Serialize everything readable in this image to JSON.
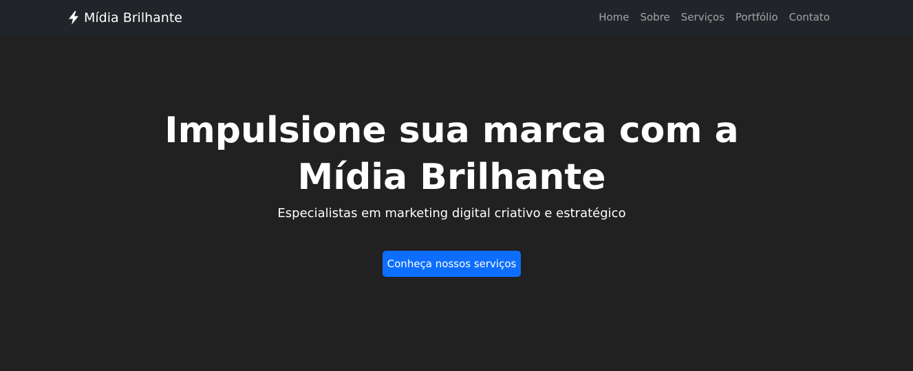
{
  "navbar": {
    "brand_icon": "bolt-icon",
    "brand": "Mídia Brilhante",
    "links": [
      "Home",
      "Sobre",
      "Serviços",
      "Portfólio",
      "Contato"
    ]
  },
  "hero": {
    "title": "Impulsione sua marca com a Mídia Brilhante",
    "subtitle": "Especialistas em marketing digital criativo e estratégico",
    "cta": "Conheça nossos serviços"
  },
  "colors": {
    "background": "#212121",
    "navbar": "#212529",
    "accent": "#0d6efd"
  }
}
